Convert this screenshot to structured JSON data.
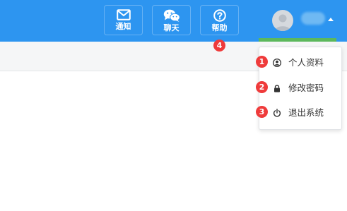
{
  "toolbar": {
    "notify_label": "通知",
    "chat_label": "聊天",
    "help_label": "帮助"
  },
  "user_menu": {
    "items": [
      {
        "label": "个人资料",
        "icon": "user-circle-icon"
      },
      {
        "label": "修改密码",
        "icon": "lock-icon"
      },
      {
        "label": "退出系统",
        "icon": "power-icon"
      }
    ]
  },
  "annotations": {
    "badge_1": "1",
    "badge_2": "2",
    "badge_3": "3",
    "badge_4": "4"
  },
  "colors": {
    "topbar": "#2d95f0",
    "badge": "#ef3b3b",
    "active_indicator": "#5cb85c"
  }
}
